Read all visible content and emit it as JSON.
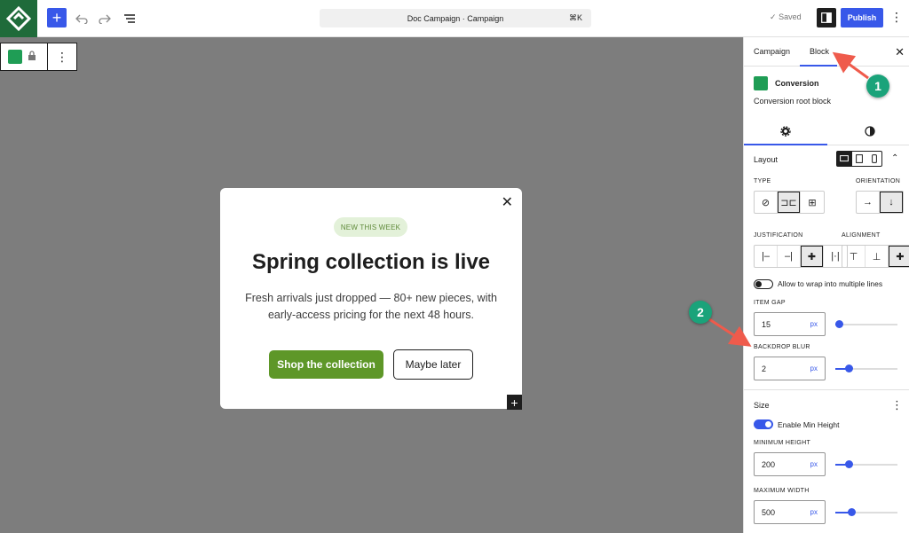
{
  "topbar": {
    "command_title": "Doc Campaign · Campaign",
    "command_shortcut": "⌘K",
    "saved_label": "Saved",
    "publish_label": "Publish"
  },
  "popup": {
    "badge": "NEW THIS WEEK",
    "headline": "Spring collection is live",
    "body": "Fresh arrivals just dropped — 80+ new pieces, with early-access pricing for the next 48 hours.",
    "primary_cta": "Shop the collection",
    "secondary_cta": "Maybe later",
    "close_glyph": "✕"
  },
  "sidebar": {
    "tabs": [
      {
        "label": "Campaign"
      },
      {
        "label": "Block",
        "active": true
      }
    ],
    "block": {
      "title": "Conversion",
      "description": "Conversion root block"
    },
    "layout": {
      "title": "Layout",
      "type_label": "TYPE",
      "orientation_label": "ORIENTATION",
      "justification_label": "JUSTIFICATION",
      "alignment_label": "ALIGNMENT",
      "wrap_label": "Allow to wrap into multiple lines",
      "wrap_enabled": false,
      "item_gap_label": "ITEM GAP",
      "item_gap_value": "15",
      "item_gap_unit": "px",
      "backdrop_blur_label": "BACKDROP BLUR",
      "backdrop_blur_value": "2",
      "backdrop_blur_unit": "px"
    },
    "size": {
      "title": "Size",
      "min_height_toggle_label": "Enable Min Height",
      "min_height_enabled": true,
      "min_height_label": "MINIMUM HEIGHT",
      "min_height_value": "200",
      "min_height_unit": "px",
      "max_width_label": "MAXIMUM WIDTH",
      "max_width_value": "500",
      "max_width_unit": "px"
    }
  },
  "annotations": {
    "callout_1": "1",
    "callout_2": "2"
  },
  "colors": {
    "accent": "#3858e9",
    "brand_green": "#1f6b3a",
    "cta_green": "#5e9728",
    "canvas_gray": "#7d7d7d",
    "callout": "#1aa37a",
    "arrow": "#ef5b4c"
  }
}
